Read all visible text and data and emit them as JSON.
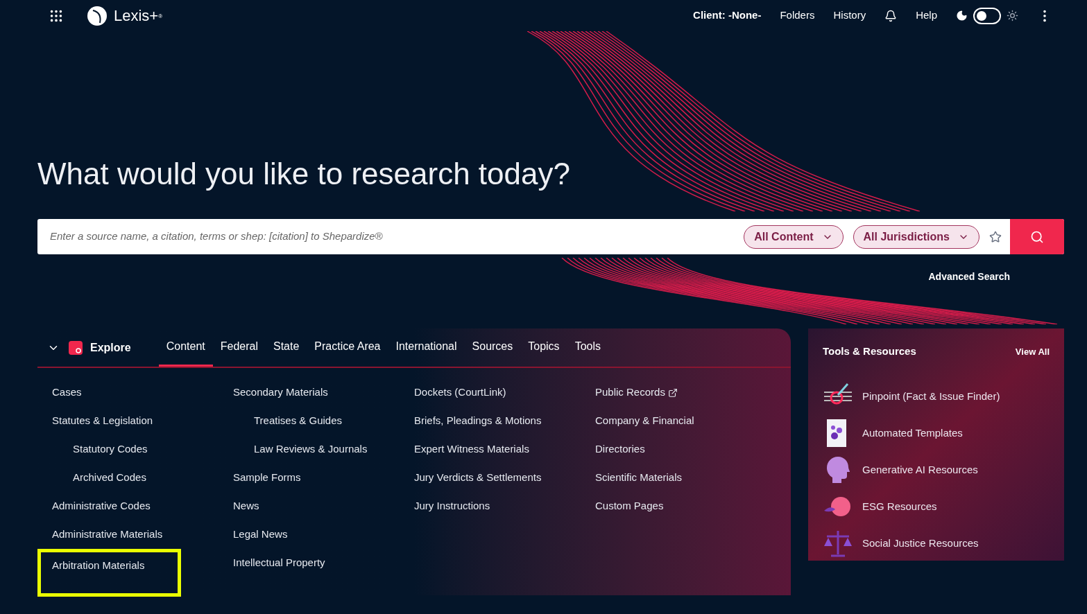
{
  "top_bar": {
    "logo": "Lexis+",
    "logo_mark": "®",
    "client": "Client: -None-",
    "links": [
      "Folders",
      "History"
    ],
    "help": "Help",
    "light_mode": false
  },
  "heading": "What would you like to research today?",
  "search": {
    "placeholder": "Enter a source name, a citation, terms or shep: [citation] to Shepardize®",
    "filters": [
      "All Content",
      "All Jurisdictions"
    ],
    "advanced": "Advanced Search"
  },
  "explore": {
    "title": "Explore",
    "expanded": true,
    "tabs": [
      {
        "label": "Content",
        "selected": true
      },
      {
        "label": "Federal",
        "selected": false
      },
      {
        "label": "State",
        "selected": false
      },
      {
        "label": "Practice Area",
        "selected": false
      },
      {
        "label": "International",
        "selected": false
      },
      {
        "label": "Sources",
        "selected": false
      },
      {
        "label": "Topics",
        "selected": false
      },
      {
        "label": "Tools",
        "selected": false
      }
    ],
    "columns": [
      [
        {
          "label": "Cases",
          "highlighted": false
        },
        {
          "label": "Statutes & Legislation",
          "highlighted": false,
          "children": [
            {
              "label": "Statutory Codes",
              "highlighted": false
            },
            {
              "label": "Archived Codes",
              "highlighted": false
            }
          ]
        },
        {
          "label": "Administrative Codes",
          "highlighted": false
        },
        {
          "label": "Administrative Materials",
          "highlighted": false
        },
        {
          "label": "Arbitration Materials",
          "highlighted": true
        }
      ],
      [
        {
          "label": "Secondary Materials",
          "highlighted": false,
          "children": [
            {
              "label": "Treatises & Guides",
              "highlighted": false
            },
            {
              "label": "Law Reviews & Journals",
              "highlighted": false
            }
          ]
        },
        {
          "label": "Sample Forms",
          "highlighted": false
        },
        {
          "label": "News",
          "highlighted": false
        },
        {
          "label": "Legal News",
          "highlighted": false
        },
        {
          "label": "Intellectual Property",
          "highlighted": false
        }
      ],
      [
        {
          "label": "Dockets (CourtLink)",
          "highlighted": false
        },
        {
          "label": "Briefs, Pleadings & Motions",
          "highlighted": false
        },
        {
          "label": "Expert Witness Materials",
          "highlighted": false
        },
        {
          "label": "Jury Verdicts & Settlements",
          "highlighted": false
        },
        {
          "label": "Jury Instructions",
          "highlighted": false
        }
      ],
      [
        {
          "label": "Public Records",
          "highlighted": false,
          "external": true
        },
        {
          "label": "Company & Financial",
          "highlighted": false
        },
        {
          "label": "Directories",
          "highlighted": false
        },
        {
          "label": "Scientific Materials",
          "highlighted": false
        },
        {
          "label": "Custom Pages",
          "highlighted": false
        }
      ]
    ]
  },
  "tools": {
    "title": "Tools & Resources",
    "view_all": "View All",
    "items": [
      {
        "label": "Pinpoint (Fact & Issue Finder)",
        "kind": "pinpoint"
      },
      {
        "label": "Automated Templates",
        "kind": "templates"
      },
      {
        "label": "Generative AI Resources",
        "kind": "ai"
      },
      {
        "label": "ESG Resources",
        "kind": "esg"
      },
      {
        "label": "Social Justice Resources",
        "kind": "justice"
      }
    ]
  }
}
